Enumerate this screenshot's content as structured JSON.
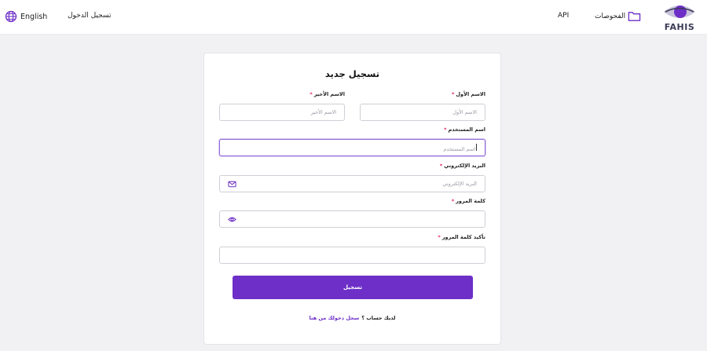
{
  "header": {
    "language_label": "English",
    "login_label": "تسجيل الدخول",
    "api_label": "API",
    "exams_label": "الفحوصات",
    "logo_text": "FAHIS",
    "icons": {
      "language": "globe-icon",
      "exams": "folder-icon",
      "logo": "eye-logo"
    }
  },
  "form": {
    "title": "تسجيل جديد",
    "first_name": {
      "label": "الاسم الأول",
      "placeholder": "الاسم الأول"
    },
    "last_name": {
      "label": "الاسم الأخير",
      "placeholder": "الاسم الأخير"
    },
    "username": {
      "label": "اسم المستخدم",
      "placeholder": "اسم المستخدم"
    },
    "email": {
      "label": "البريد الإلكتروني",
      "placeholder": "البريد الإلكتروني",
      "icon": "mail-icon"
    },
    "password": {
      "label": "كلمة المرور",
      "placeholder": "",
      "icon": "eye-icon"
    },
    "confirm_password": {
      "label": "تأكيد كلمة المرور",
      "placeholder": ""
    },
    "required_marker": "*",
    "submit_label": "تسجيل",
    "have_account_text": "لديك حساب ؟",
    "signin_link": "سجل دخولك من هنا"
  },
  "colors": {
    "accent": "#6d2fc7",
    "required": "#e0245e",
    "background": "#f1f1f3"
  }
}
